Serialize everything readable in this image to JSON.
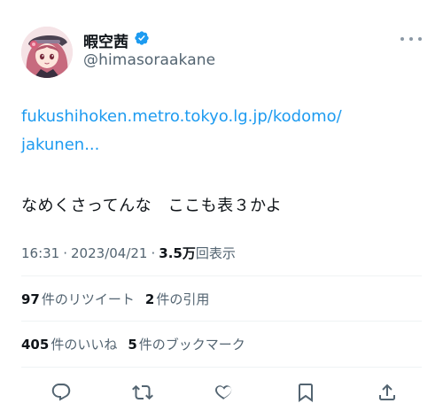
{
  "author": {
    "display_name": "暇空茜",
    "handle": "@himasoraakane",
    "verified": true,
    "badge_color": "#1d9bf0"
  },
  "tweet": {
    "link_line1": "fukushihoken.metro.tokyo.lg.jp/kodomo/",
    "link_line2": "jakunen...",
    "text": "なめくさってんな　ここも表３かよ",
    "time": "16:31",
    "date": "2023/04/21",
    "separator": "·",
    "views_count": "3.5万",
    "views_label": "回表示"
  },
  "stats": {
    "retweets_count": "97",
    "retweets_label": "件のリツイート",
    "quotes_count": "2",
    "quotes_label": "件の引用",
    "likes_count": "405",
    "likes_label": "件のいいね",
    "bookmarks_count": "5",
    "bookmarks_label": "件のブックマーク"
  },
  "actions": {
    "icons": [
      "reply-icon",
      "retweet-icon",
      "like-icon",
      "bookmark-icon",
      "share-icon"
    ]
  },
  "colors": {
    "link": "#1d9bf0",
    "secondary_text": "#536471",
    "primary_text": "#0f1419",
    "divider": "#eff3f4"
  }
}
